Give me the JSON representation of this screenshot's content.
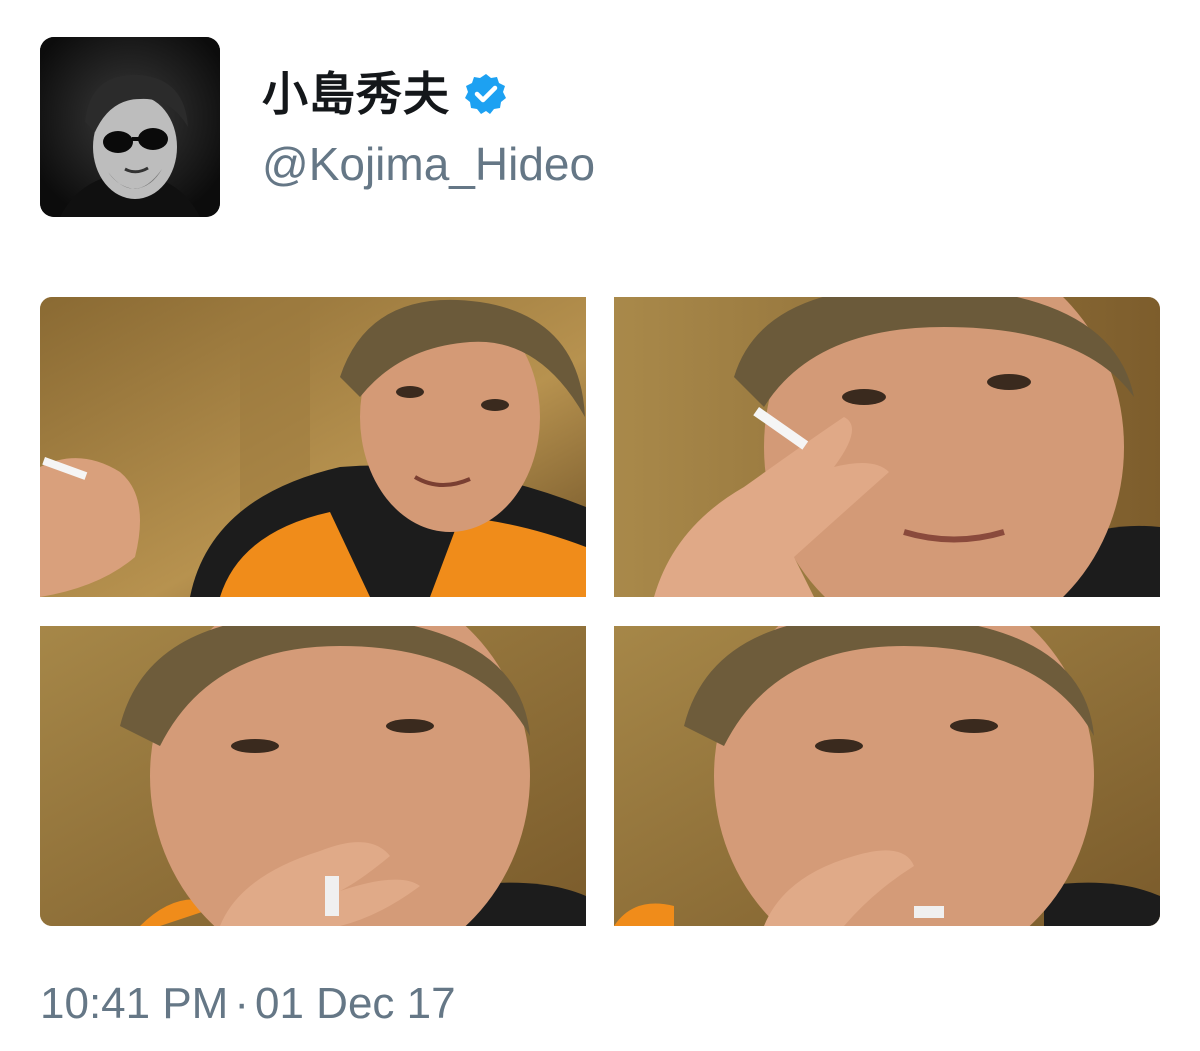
{
  "user": {
    "display_name": "小島秀夫",
    "handle": "@Kojima_Hideo",
    "verified": true,
    "avatar_icon": "profile-avatar-photo"
  },
  "media": {
    "photos": [
      {
        "alt": "photo-1"
      },
      {
        "alt": "photo-2"
      },
      {
        "alt": "photo-3"
      },
      {
        "alt": "photo-4"
      }
    ]
  },
  "meta": {
    "time": "10:41 PM",
    "separator": "·",
    "date": "01 Dec 17"
  },
  "colors": {
    "verified_blue": "#1da1f2",
    "name_text": "#14171a",
    "secondary_text": "#657786",
    "jacket_orange": "#f08c1a",
    "background_warm": "#b8914d"
  }
}
